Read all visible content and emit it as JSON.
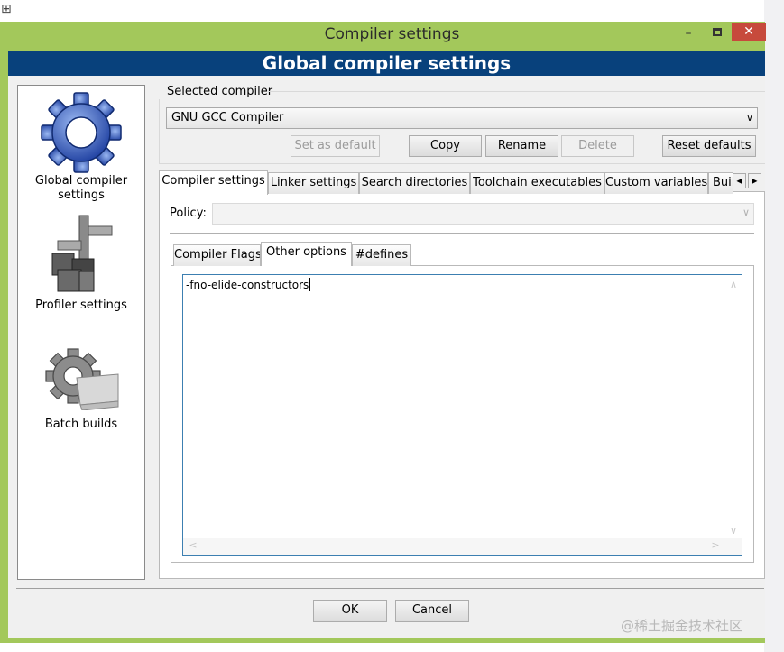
{
  "window": {
    "title": "Compiler settings",
    "minimize": "–",
    "close": "✕"
  },
  "banner": {
    "title": "Global compiler settings"
  },
  "sidebar": {
    "items": [
      {
        "label_line1": "Global compiler",
        "label_line2": "settings",
        "icon": "gear-icon"
      },
      {
        "label": "Profiler settings",
        "icon": "caliper-icon"
      },
      {
        "label": "Batch builds",
        "icon": "gear-stack-icon"
      }
    ]
  },
  "compiler": {
    "group_label": "Selected compiler",
    "selected": "GNU GCC Compiler",
    "buttons": {
      "set_default": "Set as default",
      "copy": "Copy",
      "rename": "Rename",
      "delete": "Delete",
      "reset": "Reset defaults"
    }
  },
  "tabs": [
    "Compiler settings",
    "Linker settings",
    "Search directories",
    "Toolchain executables",
    "Custom variables",
    "Build options"
  ],
  "policy": {
    "label": "Policy:",
    "value": ""
  },
  "subtabs": [
    "Compiler Flags",
    "Other options",
    "#defines"
  ],
  "other_options": {
    "text": "-fno-elide-constructors"
  },
  "footer": {
    "ok": "OK",
    "cancel": "Cancel"
  },
  "watermark": "@稀土掘金技术社区",
  "colors": {
    "frame": "#a3c85b",
    "banner": "#08417c",
    "close": "#c74a3c"
  }
}
